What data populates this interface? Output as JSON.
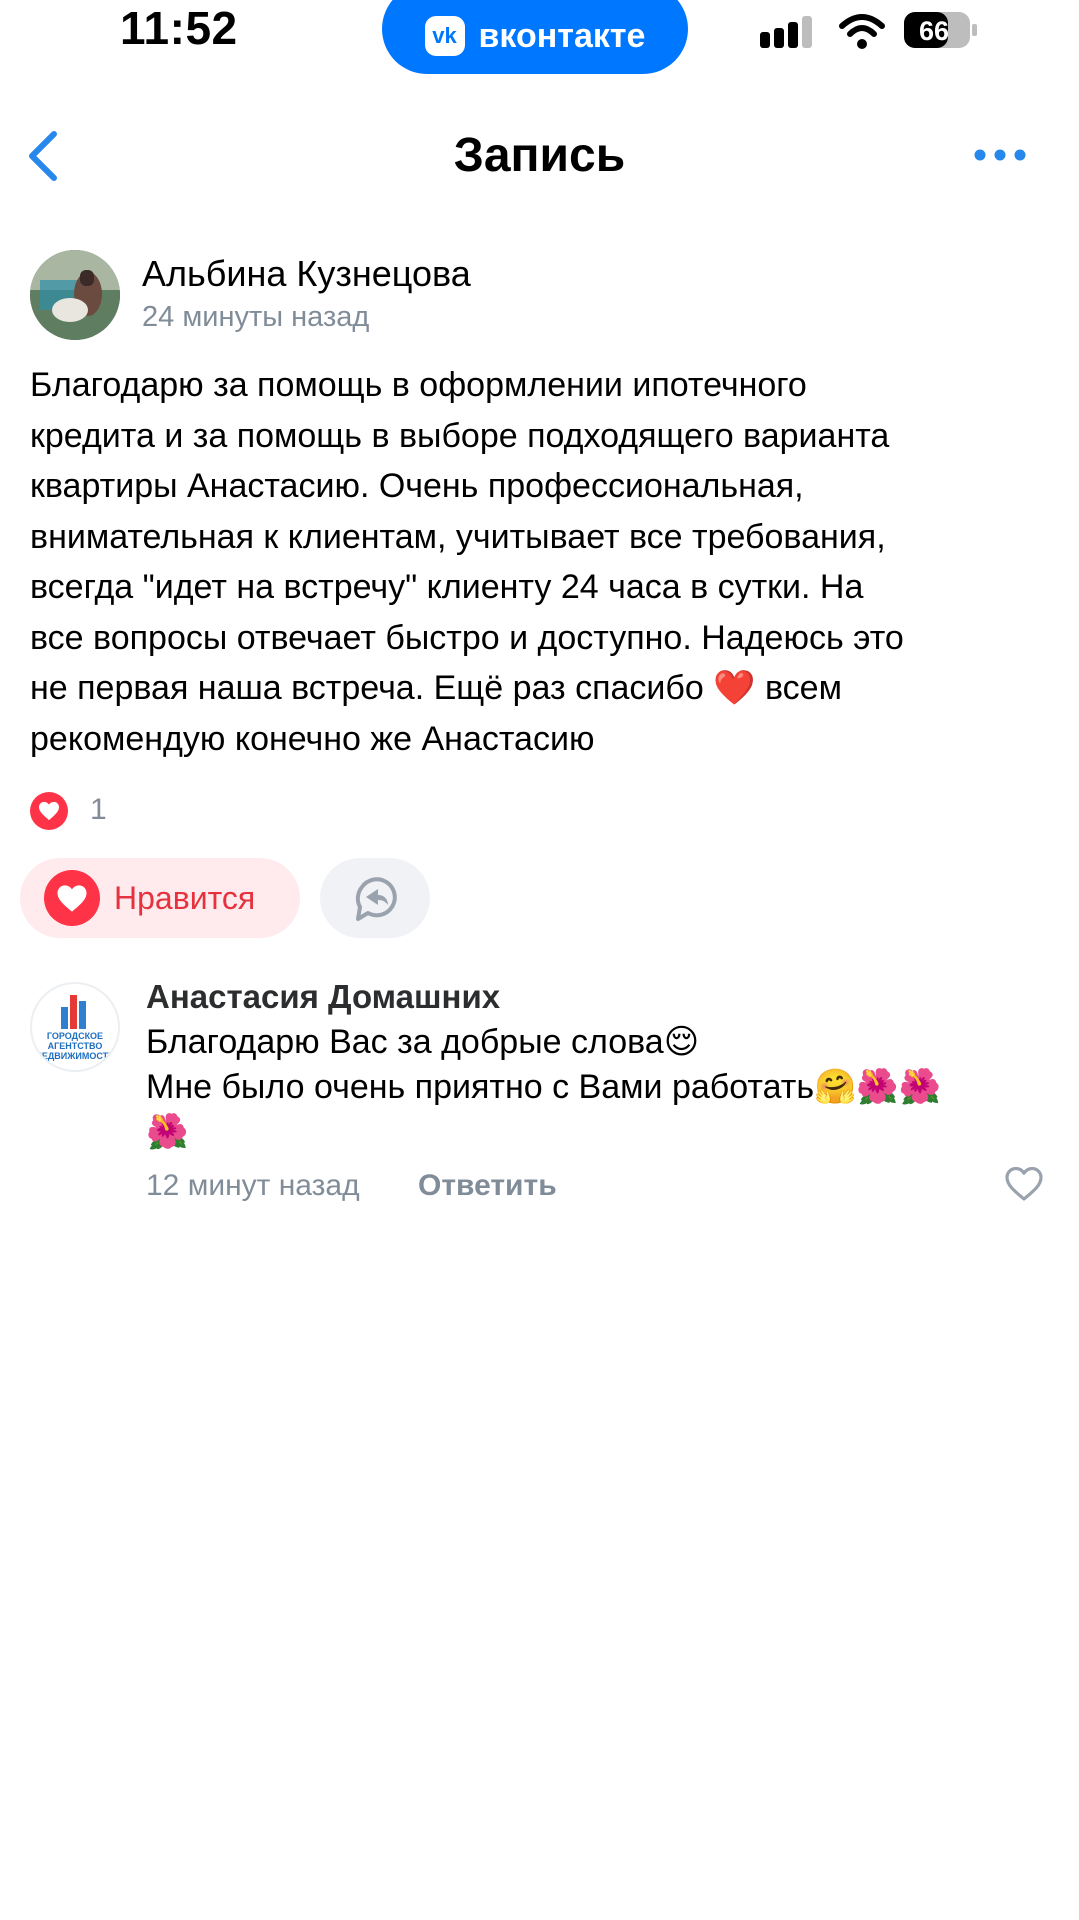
{
  "status_bar": {
    "time": "11:52",
    "app_badge": "вконтакте",
    "battery": "66"
  },
  "header": {
    "title": "Запись"
  },
  "post": {
    "author": "Альбина Кузнецова",
    "time_ago": "24 минуты назад",
    "text": "Благодарю за помощь в оформлении ипотечного\nкредита и за помощь в выборе подходящего варианта\nквартиры Анастасию. Очень профессиональная,\nвнимательная к клиентам, учитывает все требования,\nвсегда \"идет на встречу\" клиенту 24 часа в сутки. На\nвсе вопросы отвечает быстро и доступно. Надеюсь это\nне первая наша встреча. Ещё раз спасибо ❤️ всем\nрекомендую конечно же Анастасию",
    "likes_count": "1",
    "like_button_label": "Нравится"
  },
  "comment": {
    "author": "Анастасия Домашних",
    "avatar_text": "ГОРОДСКОЕ АГЕНТСТВО НЕДВИЖИМОСТИ",
    "text": "Благодарю Вас за добрые слова😌\nМне было очень приятно с Вами работать🤗🌺🌺\n🌺",
    "time_ago": "12 минут назад",
    "reply_label": "Ответить"
  },
  "colors": {
    "vk_blue": "#0077ff",
    "like_red": "#ff3347",
    "secondary_text": "#818c99"
  }
}
